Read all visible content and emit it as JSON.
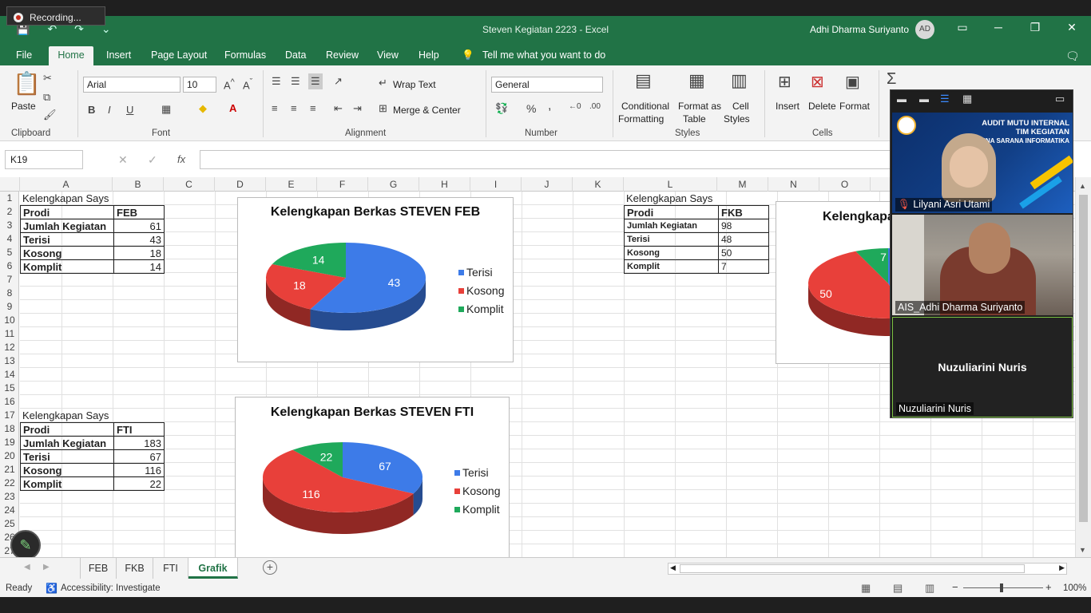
{
  "recording": {
    "label": "Recording..."
  },
  "window": {
    "title": "Steven Kegiatan 2223  -  Excel",
    "user_name": "Adhi Dharma Suriyanto",
    "user_initials": "AD",
    "minimize": "─",
    "restore": "❐",
    "close": "✕"
  },
  "ribbon_tabs": [
    "File",
    "Home",
    "Insert",
    "Page Layout",
    "Formulas",
    "Data",
    "Review",
    "View",
    "Help",
    "Tell me what you want to do"
  ],
  "ribbon": {
    "clipboard": {
      "paste": "Paste",
      "group": "Clipboard"
    },
    "font": {
      "name": "Arial",
      "size": "10",
      "bold": "B",
      "italic": "I",
      "underline": "U",
      "group": "Font"
    },
    "alignment": {
      "wrap": "Wrap Text",
      "merge": "Merge & Center",
      "group": "Alignment"
    },
    "number": {
      "format": "General",
      "percent": "%",
      "comma": ",",
      "group": "Number"
    },
    "styles": {
      "conditional": "Conditional",
      "conditional2": "Formatting",
      "format_as": "Format as",
      "format_as2": "Table",
      "cell": "Cell",
      "cell2": "Styles",
      "group": "Styles"
    },
    "cells": {
      "insert": "Insert",
      "delete": "Delete",
      "format": "Format",
      "group": "Cells"
    }
  },
  "formula_bar": {
    "name_box": "K19",
    "fx": "fx"
  },
  "columns": [
    "A",
    "B",
    "C",
    "D",
    "E",
    "F",
    "G",
    "H",
    "I",
    "J",
    "K",
    "L",
    "M",
    "N",
    "O"
  ],
  "rows": [
    "1",
    "2",
    "3",
    "4",
    "5",
    "6",
    "7",
    "8",
    "9",
    "10",
    "11",
    "12",
    "13",
    "14",
    "15",
    "16",
    "17",
    "18",
    "19",
    "20",
    "21",
    "22",
    "23",
    "24",
    "25",
    "26",
    "27"
  ],
  "table_feb": {
    "title": "Kelengkapan Says",
    "header": [
      "Prodi",
      "FEB"
    ],
    "rows": [
      [
        "Jumlah Kegiatan",
        "61"
      ],
      [
        "Terisi",
        "43"
      ],
      [
        "Kosong",
        "18"
      ],
      [
        "Komplit",
        "14"
      ]
    ]
  },
  "table_fti": {
    "title": "Kelengkapan Says",
    "header": [
      "Prodi",
      "FTI"
    ],
    "rows": [
      [
        "Jumlah Kegiatan",
        "183"
      ],
      [
        "Terisi",
        "67"
      ],
      [
        "Kosong",
        "116"
      ],
      [
        "Komplit",
        "22"
      ]
    ]
  },
  "table_fkb": {
    "title": "Kelengkapan Says",
    "header": [
      "Prodi",
      "FKB"
    ],
    "rows": [
      [
        "Jumlah Kegiatan",
        "98"
      ],
      [
        "Terisi",
        "48"
      ],
      [
        "Kosong",
        "50"
      ],
      [
        "Komplit",
        "7"
      ]
    ]
  },
  "colors": {
    "terisi": "#3d7be8",
    "kosong": "#e8403a",
    "komplit": "#1fa95b",
    "excel_green": "#217346"
  },
  "chart_data": [
    {
      "type": "pie",
      "title": "Kelengkapan Berkas STEVEN FEB",
      "categories": [
        "Terisi",
        "Kosong",
        "Komplit"
      ],
      "values": [
        43,
        18,
        14
      ],
      "data_labels": [
        "43",
        "18",
        "14"
      ]
    },
    {
      "type": "pie",
      "title": "Kelengkapan Berkas STEVEN FTI",
      "categories": [
        "Terisi",
        "Kosong",
        "Komplit"
      ],
      "values": [
        67,
        116,
        22
      ],
      "data_labels": [
        "67",
        "116",
        "22"
      ]
    },
    {
      "type": "pie",
      "title": "Kelengkapa",
      "categories": [
        "Terisi",
        "Kosong",
        "Komplit"
      ],
      "values": [
        48,
        50,
        7
      ],
      "data_labels": [
        "50",
        "7"
      ]
    }
  ],
  "sheet_tabs": [
    "FEB",
    "FKB",
    "FTI",
    "Grafik"
  ],
  "active_sheet": "Grafik",
  "status": {
    "ready": "Ready",
    "accessibility": "Accessibility: Investigate",
    "zoom": "100%"
  },
  "zoom_meeting": {
    "participants": [
      {
        "name": "Lilyani Asri Utami",
        "banner_line1": "AUDIT MUTU INTERNAL",
        "banner_line2": "TIM KEGIATAN",
        "banner_line3": "BINA SARANA INFORMATIKA"
      },
      {
        "name": "AIS_Adhi Dharma Suriyanto"
      },
      {
        "name": "Nuzuliarini Nuris",
        "display": "Nuzuliarini Nuris"
      }
    ]
  }
}
